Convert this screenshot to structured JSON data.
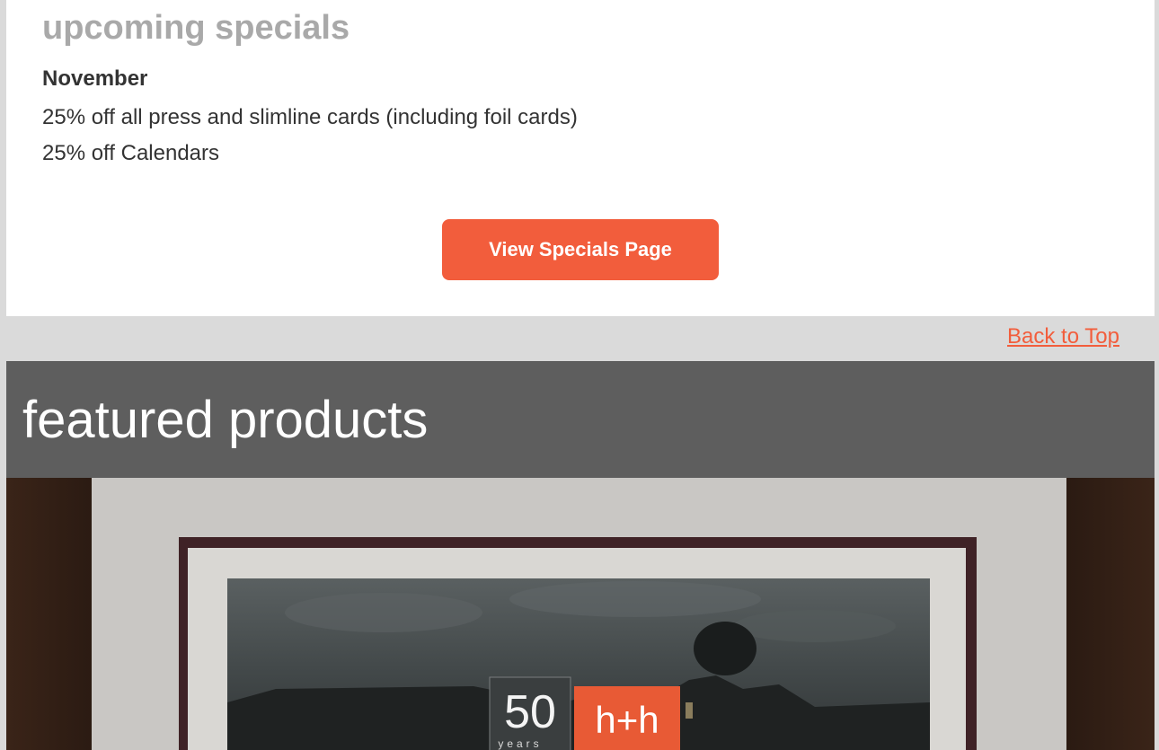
{
  "specials": {
    "title": "upcoming specials",
    "month": "November",
    "items": [
      "25% off all press and slimline cards (including foil cards)",
      "25% off Calendars"
    ],
    "button_label": "View Specials Page"
  },
  "back_to_top": "Back to Top",
  "featured": {
    "title": "featured products",
    "logo": {
      "number": "50",
      "years": "years",
      "brand": "h+h"
    }
  },
  "colors": {
    "accent": "#f25d3c",
    "header_bg": "#5e5e5e",
    "page_bg": "#dadada",
    "title_gray": "#a9a9a9"
  }
}
